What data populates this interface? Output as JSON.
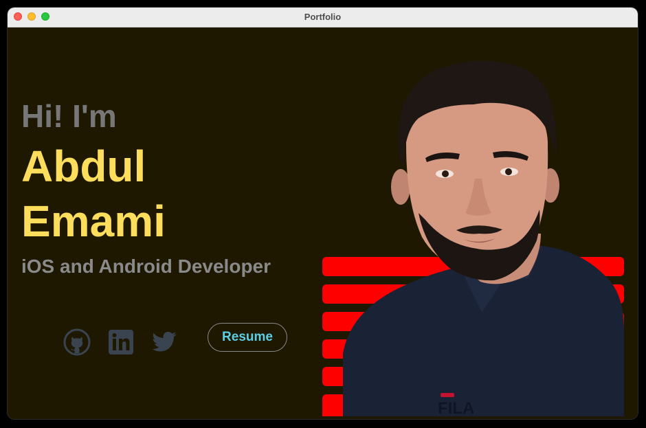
{
  "window": {
    "title": "Portfolio"
  },
  "hero": {
    "greeting": "Hi! I'm",
    "first_name": "Abdul",
    "last_name": "Emami",
    "role": "iOS and Android Developer"
  },
  "socials": [
    {
      "icon": "github-icon"
    },
    {
      "icon": "linkedin-icon"
    },
    {
      "icon": "twitter-icon"
    }
  ],
  "resume_label": "Resume",
  "portrait": {
    "shirt_logo": "FILA"
  },
  "colors": {
    "background": "#1f1801",
    "name": "#fddd5c",
    "greeting": "#777777",
    "role": "#8a8a8a",
    "icons": "#3a4450",
    "resume_text": "#5ccfe6",
    "stripes": "#ff0000",
    "shirt": "#1a2235"
  }
}
